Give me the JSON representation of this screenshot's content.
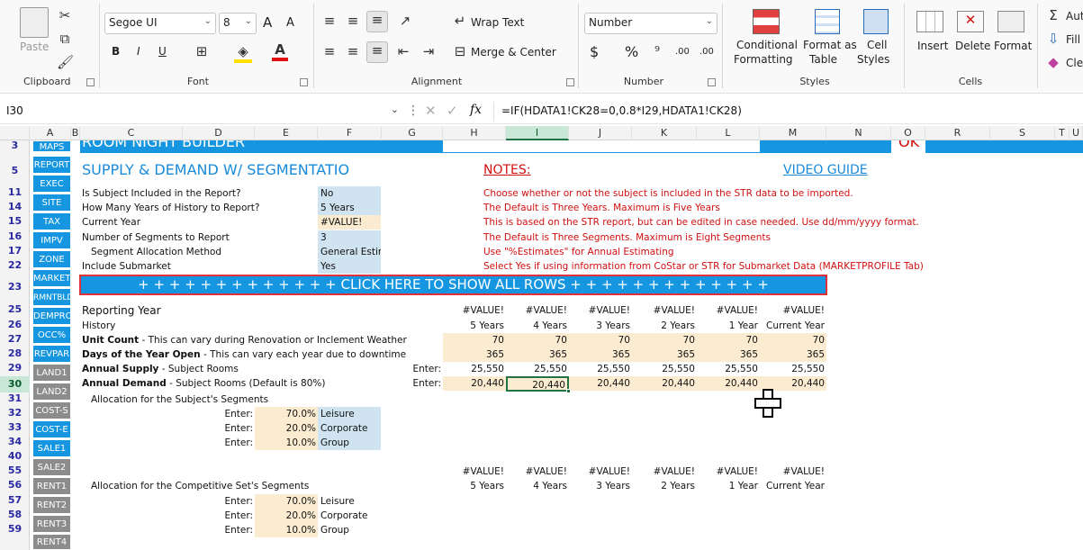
{
  "ribbon": {
    "clipboard": {
      "paste": "Paste",
      "label": "Clipboard"
    },
    "font": {
      "family": "Segoe UI",
      "size": "8",
      "label": "Font",
      "bold": "B",
      "italic": "I",
      "underline": "U",
      "grow": "A",
      "shrink": "A"
    },
    "alignment": {
      "wrap": "Wrap Text",
      "merge": "Merge & Center",
      "label": "Alignment"
    },
    "number": {
      "format": "Number",
      "currency": "$",
      "percent": "%",
      "comma": "9",
      "inc": ".00",
      "dec": ".00",
      "label": "Number"
    },
    "styles": {
      "cond1": "Conditional",
      "cond2": "Formatting",
      "fmt1": "Format as",
      "fmt2": "Table",
      "cell1": "Cell",
      "cell2": "Styles",
      "label": "Styles"
    },
    "cells": {
      "insert": "Insert",
      "delete": "Delete",
      "format": "Format",
      "label": "Cells"
    },
    "editing": {
      "autosum": "Aut",
      "fill": "Fill",
      "clear": "Clea"
    }
  },
  "formula_bar": {
    "name_box": "I30",
    "fx": "fx",
    "formula": "=IF(HDATA1!CK28=0,0.8*I29,HDATA1!CK28)"
  },
  "columns": [
    "A",
    "B",
    "C",
    "D",
    "E",
    "F",
    "G",
    "H",
    "I",
    "J",
    "K",
    "L",
    "M",
    "N",
    "O",
    "R",
    "S",
    "T",
    "U"
  ],
  "rows": [
    "3",
    "5",
    "11",
    "14",
    "15",
    "16",
    "17",
    "22",
    "23",
    "25",
    "26",
    "27",
    "28",
    "29",
    "30",
    "31",
    "32",
    "33",
    "34",
    "40",
    "55",
    "56",
    "57",
    "58",
    "59"
  ],
  "nav": [
    "MAPS",
    "REPORT",
    "EXEC",
    "SITE",
    "TAX",
    "IMPV",
    "ZONE",
    "MARKET",
    "RMNTBLDR",
    "DEMPROJ",
    "OCC%",
    "REVPAR",
    "LAND1",
    "LAND2",
    "COST-S",
    "COST-E",
    "SALE1",
    "SALE2",
    "RENT1",
    "RENT2",
    "RENT3",
    "RENT4"
  ],
  "sheet": {
    "top_title": "ROOM NIGHT BUILDER",
    "top_right": "OK",
    "title": "SUPPLY & DEMAND W/ SEGMENTATIO",
    "notes": "NOTES:",
    "video": "VIDEO GUIDE",
    "settings": [
      {
        "label": "Is Subject Included in the Report?",
        "value": "No",
        "note": "Choose whether or not the subject is included in the STR data to be imported."
      },
      {
        "label": "How Many Years of History to Report?",
        "value": "5 Years",
        "note": "The Default is Three Years. Maximum is Five Years"
      },
      {
        "label": "Current Year",
        "value": "#VALUE!",
        "note": "This is based on the STR report, but can be edited in case needed. Use dd/mm/yyyy format."
      },
      {
        "label": "Number of Segments to Report",
        "value": "3",
        "note": "The Default is Three Segments. Maximum is Eight Segments"
      },
      {
        "label": "Segment Allocation Method",
        "value": "General Estima",
        "note": "Use \"%Estimates\" for Annual Estimating"
      },
      {
        "label": "Include Submarket",
        "value": "Yes",
        "note": "Select Yes if using information from CoStar or STR for Submarket Data (MARKETPROFILE Tab)"
      }
    ],
    "banner": "+ + + + + + + + + + + + + CLICK HERE TO SHOW ALL ROWS + + + + + + + + + + + + +",
    "reporting_year": "Reporting Year",
    "history": "History",
    "unit_count_b": "Unit Count",
    "unit_count": " - This can vary during Renovation or Inclement Weather",
    "days_open_b": "Days of the Year Open",
    "days_open": " - This can vary each year due to downtime",
    "supply_b": "Annual Supply",
    "supply": "  - Subject Rooms",
    "demand_b": "Annual Demand",
    "demand": " - Subject Rooms (Default is 80%)",
    "enter": "Enter:",
    "years_hdr": [
      "#VALUE!",
      "#VALUE!",
      "#VALUE!",
      "#VALUE!",
      "#VALUE!",
      "#VALUE!"
    ],
    "years": [
      "5 Years",
      "4 Years",
      "3 Years",
      "2 Years",
      "1 Year",
      "Current Year"
    ],
    "unit_vals": [
      "70",
      "70",
      "70",
      "70",
      "70",
      "70"
    ],
    "days_vals": [
      "365",
      "365",
      "365",
      "365",
      "365",
      "365"
    ],
    "supply_vals": [
      "25,550",
      "25,550",
      "25,550",
      "25,550",
      "25,550",
      "25,550"
    ],
    "demand_vals": [
      "20,440",
      "20,440",
      "20,440",
      "20,440",
      "20,440",
      "20,440"
    ],
    "alloc_subject": "Allocation for the Subject's Segments",
    "alloc_comp": "Allocation for the Competitive Set's Segments",
    "segments": [
      {
        "pct": "70.0%",
        "name": "Leisure"
      },
      {
        "pct": "20.0%",
        "name": "Corporate"
      },
      {
        "pct": "10.0%",
        "name": "Group"
      }
    ]
  },
  "colors": {
    "accent": "#1696e0",
    "excel_green": "#217346",
    "red_note": "#d01010"
  }
}
